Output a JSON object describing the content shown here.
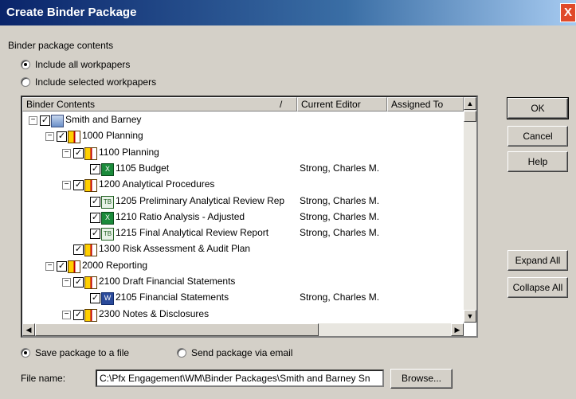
{
  "window": {
    "title": "Create Binder Package",
    "close": "X"
  },
  "contents_label": "Binder package contents",
  "radios": {
    "all": {
      "label": "Include all workpapers",
      "checked": true
    },
    "selected": {
      "label": "Include selected workpapers",
      "checked": false
    },
    "file": {
      "label": "Save package to a file",
      "checked": true
    },
    "email": {
      "label": "Send package via email",
      "checked": false
    }
  },
  "tree": {
    "columns": [
      "Binder Contents",
      "/",
      "Current Editor",
      "Assigned To"
    ],
    "items": [
      {
        "label": "Smith and Barney",
        "editor": ""
      },
      {
        "label": "1000 Planning",
        "editor": ""
      },
      {
        "label": "1100 Planning",
        "editor": ""
      },
      {
        "label": "1105 Budget",
        "editor": "Strong, Charles M."
      },
      {
        "label": "1200 Analytical Procedures",
        "editor": ""
      },
      {
        "label": "1205 Preliminary Analytical Review Rep",
        "editor": "Strong, Charles M."
      },
      {
        "label": "1210 Ratio Analysis - Adjusted",
        "editor": "Strong, Charles M."
      },
      {
        "label": "1215 Final Analytical Review Report",
        "editor": "Strong, Charles M."
      },
      {
        "label": "1300 Risk Assessment & Audit Plan",
        "editor": ""
      },
      {
        "label": "2000 Reporting",
        "editor": ""
      },
      {
        "label": "2100 Draft Financial Statements",
        "editor": ""
      },
      {
        "label": "2105 Financial Statements",
        "editor": "Strong, Charles M."
      },
      {
        "label": "2300 Notes & Disclosures",
        "editor": ""
      }
    ]
  },
  "buttons": {
    "ok": "OK",
    "cancel": "Cancel",
    "help": "Help",
    "expand_all": "Expand All",
    "collapse_all": "Collapse All",
    "browse": "Browse..."
  },
  "file": {
    "label": "File name:",
    "value": "C:\\Pfx Engagement\\WM\\Binder Packages\\Smith and Barney Sn"
  },
  "icons": {
    "book": "binder-book-icon",
    "folder": "folder-icon",
    "xls": "excel-icon",
    "tb": "trial-balance-icon",
    "word": "word-icon"
  }
}
